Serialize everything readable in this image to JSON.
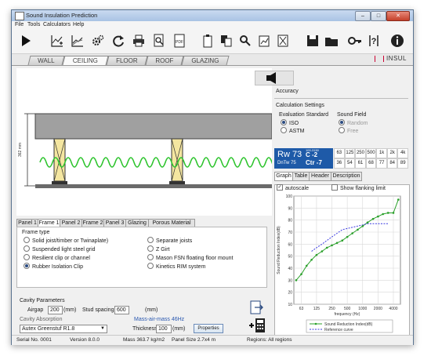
{
  "window": {
    "title": "Sound Insulation Prediction"
  },
  "menu": [
    "File",
    "Tools",
    "Calculators",
    "Help"
  ],
  "toolbar_icons": [
    "play-icon",
    "graph-add-icon",
    "graph-compare-icon",
    "settings-icon",
    "refresh-icon",
    "print-icon",
    "print-preview-icon",
    "pdf-icon",
    "clipboard-icon",
    "copy-icon",
    "lookup-icon",
    "report-icon",
    "clear-icon",
    "save-icon",
    "open-folder-icon",
    "key-icon",
    "help-icon",
    "info-icon"
  ],
  "toolbar_labels": {
    "pdf": "PDF"
  },
  "main_tabs": [
    "WALL",
    "CEILING",
    "FLOOR",
    "ROOF",
    "GLAZING"
  ],
  "brand": "INSUL",
  "drawing": {
    "dimension": "362 mm"
  },
  "accuracy_label": "Accuracy",
  "calc_settings": {
    "title": "Calculation Settings",
    "eval_label": "Evaluation Standard",
    "eval_options": [
      "ISO",
      "ASTM"
    ],
    "field_label": "Sound Field",
    "field_options": [
      "Random",
      "Free"
    ]
  },
  "rating": {
    "rw": "Rw 73",
    "c": "C -2",
    "ctr": "Ctr -7",
    "c_range": "100-3150",
    "dntw": "DnTw 75",
    "bands": [
      "63",
      "125",
      "250",
      "500",
      "1k",
      "2k",
      "4k"
    ],
    "band_values": [
      "36",
      "54",
      "61",
      "68",
      "77",
      "84",
      "89"
    ]
  },
  "result_tabs": [
    "Graph",
    "Table",
    "Header",
    "Description"
  ],
  "graph_options": {
    "autoscale": "autoscale",
    "flanking": "Show flanking limit"
  },
  "sub_tabs": [
    "Panel 1",
    "Frame 1",
    "Panel 2",
    "Frame 2",
    "Panel 3",
    "Glazing",
    "Porous Material"
  ],
  "frame_type": {
    "title": "Frame type",
    "left": [
      "Solid joist/timber or Twinaplate)",
      "Suspended light steel grid",
      "Resilient clip or channel",
      "Rubber Isolation Clip"
    ],
    "right": [
      "Separate joists",
      "Z Girt",
      "Mason FSN floating floor mount",
      "Kinetics RIM system"
    ]
  },
  "cavity": {
    "title": "Cavity Parameters",
    "airgap_label": "Airgap",
    "airgap_value": "200",
    "airgap_unit": "(mm)",
    "stud_label": "Stud spacing",
    "stud_value": "600",
    "stud_unit": "(mm)",
    "absorption_label": "Cavity Absorption",
    "mass_air_mass": "Mass-air-mass 46Hz",
    "material": "Autex Greenstuf R1.8",
    "thickness_label": "Thickness",
    "thickness_value": "100",
    "thickness_unit": "(mm)",
    "properties_button": "Properties"
  },
  "status": {
    "serial": "Serial No. 0001",
    "version": "Version 8.0.0",
    "mass": "Mass 363.7 kg/m2",
    "panel_size": "Panel Size 2.7x4 m",
    "regions": "Regions: All regions"
  },
  "chart_data": {
    "type": "line",
    "xlabel": "frequency (Hz)",
    "ylabel": "Sound Reduction Index(dB)",
    "x_ticks": [
      "63",
      "125",
      "250",
      "500",
      "1000",
      "2000",
      "4000"
    ],
    "y_ticks": [
      10,
      20,
      30,
      40,
      50,
      60,
      70,
      80,
      90,
      100
    ],
    "ylim": [
      10,
      100
    ],
    "grid": true,
    "legend_position": "bottom",
    "series": [
      {
        "name": "Sound Reduction Index(dB)",
        "color": "#2aa02a",
        "style": "solid-markers",
        "x": [
          50,
          63,
          80,
          100,
          125,
          160,
          200,
          250,
          315,
          400,
          500,
          630,
          800,
          1000,
          1250,
          1600,
          2000,
          2500,
          3150,
          4000,
          5000
        ],
        "y": [
          30,
          35,
          42,
          47,
          51,
          54,
          57,
          59,
          61,
          63,
          66,
          69,
          72,
          75,
          78,
          81,
          83,
          85,
          86,
          86,
          97
        ]
      },
      {
        "name": "Reference curve",
        "color": "#3a3ae0",
        "style": "dashed",
        "x": [
          100,
          125,
          160,
          200,
          250,
          315,
          400,
          500,
          630,
          800,
          1000,
          1250,
          1600,
          2000,
          2500,
          3150
        ],
        "y": [
          54,
          57,
          60,
          63,
          66,
          69,
          72,
          73,
          74,
          75,
          76,
          77,
          77,
          77,
          77,
          77
        ]
      }
    ]
  }
}
